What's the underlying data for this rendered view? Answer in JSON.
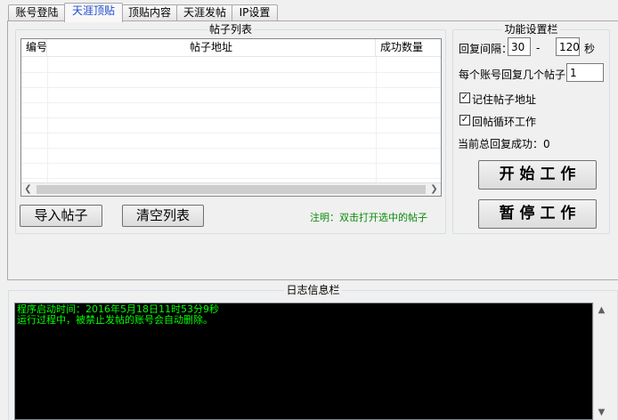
{
  "tabs": [
    {
      "label": "账号登陆"
    },
    {
      "label": "天涯顶贴"
    },
    {
      "label": "顶贴内容"
    },
    {
      "label": "天涯发帖"
    },
    {
      "label": "IP设置"
    }
  ],
  "post_list": {
    "group_title": "帖子列表",
    "columns": [
      "编号",
      "帖子地址",
      "成功数量"
    ],
    "rows": [],
    "note": "注明：双击打开选中的帖子"
  },
  "buttons": {
    "import_posts": "导入帖子",
    "clear_list": "清空列表",
    "start_work": "开 始 工 作",
    "pause_work": "暂 停 工 作"
  },
  "settings": {
    "group_title": "功能设置栏",
    "reply_interval_label": "回复间隔：",
    "interval_min": "30",
    "interval_sep": "-",
    "interval_max": "120",
    "interval_unit": "秒",
    "replies_per_account_label": "每个账号回复几个帖子：",
    "replies_per_account": "1",
    "remember_url_label": "记住帖子地址",
    "remember_url_checked": true,
    "loop_reply_label": "回帖循环工作",
    "loop_reply_checked": true,
    "total_success_label": "当前总回复成功：0"
  },
  "log": {
    "group_title": "日志信息栏",
    "lines": [
      "程序启动时间：2016年5月18日11时53分9秒",
      "运行过程中，被禁止发帖的账号会自动删除。"
    ],
    "text_color": "#00ff00",
    "background": "#000000"
  },
  "colors": {
    "active_tab_text": "#1c4bcc",
    "note_text": "#0a8a0a"
  }
}
